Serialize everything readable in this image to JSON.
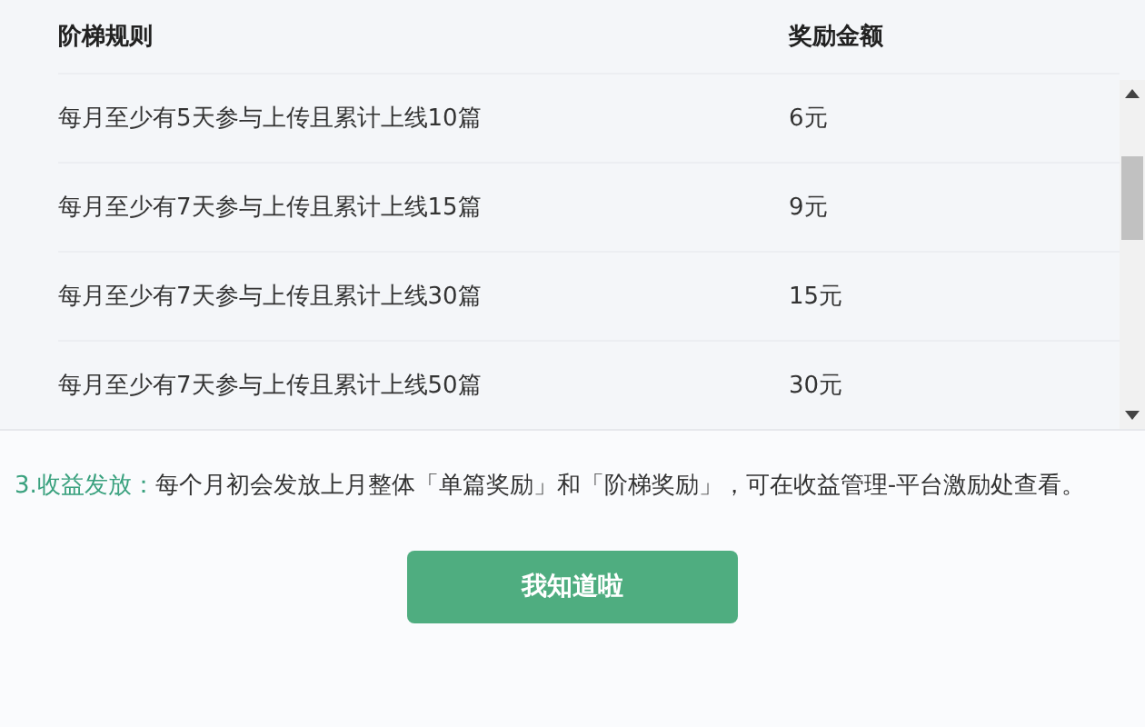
{
  "table": {
    "columns": [
      "阶梯规则",
      "奖励金额"
    ],
    "rows": [
      {
        "rule": "每月至少有5天参与上传且累计上线10篇",
        "reward": "6元"
      },
      {
        "rule": "每月至少有7天参与上传且累计上线15篇",
        "reward": "9元"
      },
      {
        "rule": "每月至少有7天参与上传且累计上线30篇",
        "reward": "15元"
      },
      {
        "rule": "每月至少有7天参与上传且累计上线50篇",
        "reward": "30元"
      }
    ]
  },
  "note": {
    "label": "3.收益发放：",
    "text": "每个月初会发放上月整体「单篇奖励」和「阶梯奖励」，可在收益管理-平台激励处查看。"
  },
  "button": "我知道啦"
}
